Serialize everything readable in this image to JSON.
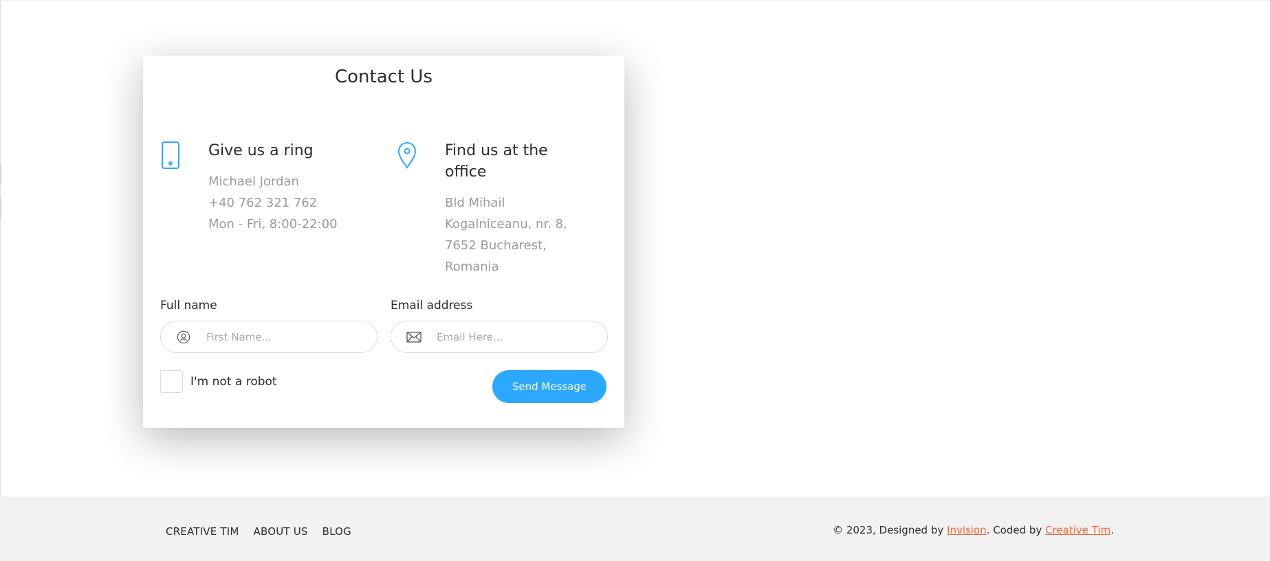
{
  "card": {
    "title": "Contact Us",
    "ring": {
      "icon": "phone-icon",
      "heading": "Give us a ring",
      "lines": [
        "Michael Jordan",
        "+40 762 321 762",
        "Mon - Fri, 8:00-22:00"
      ]
    },
    "office": {
      "icon": "map-pin-icon",
      "heading": "Find us at the office",
      "lines": [
        "Bld Mihail",
        "Kogalniceanu, nr. 8,",
        "7652 Bucharest,",
        "Romania"
      ]
    },
    "form": {
      "name_label": "Full name",
      "name_placeholder": "First Name...",
      "name_value": "",
      "name_icon": "user-circle-icon",
      "email_label": "Email address",
      "email_placeholder": "Email Here...",
      "email_value": "",
      "email_icon": "envelope-icon",
      "robot_label": "I'm not a robot",
      "send_label": "Send Message"
    }
  },
  "footer": {
    "nav": [
      "CREATIVE TIM",
      "ABOUT US",
      "BLOG"
    ],
    "copyright": {
      "prefix": "© 2023, Designed by ",
      "designer": "Invision",
      "middle": ". Coded by ",
      "coder": "Creative Tim",
      "suffix": "."
    }
  },
  "colors": {
    "accent": "#2ca8ff",
    "link": "#f96332",
    "muted_text": "#9a9a9a",
    "footer_bg": "#f2f2f2"
  }
}
